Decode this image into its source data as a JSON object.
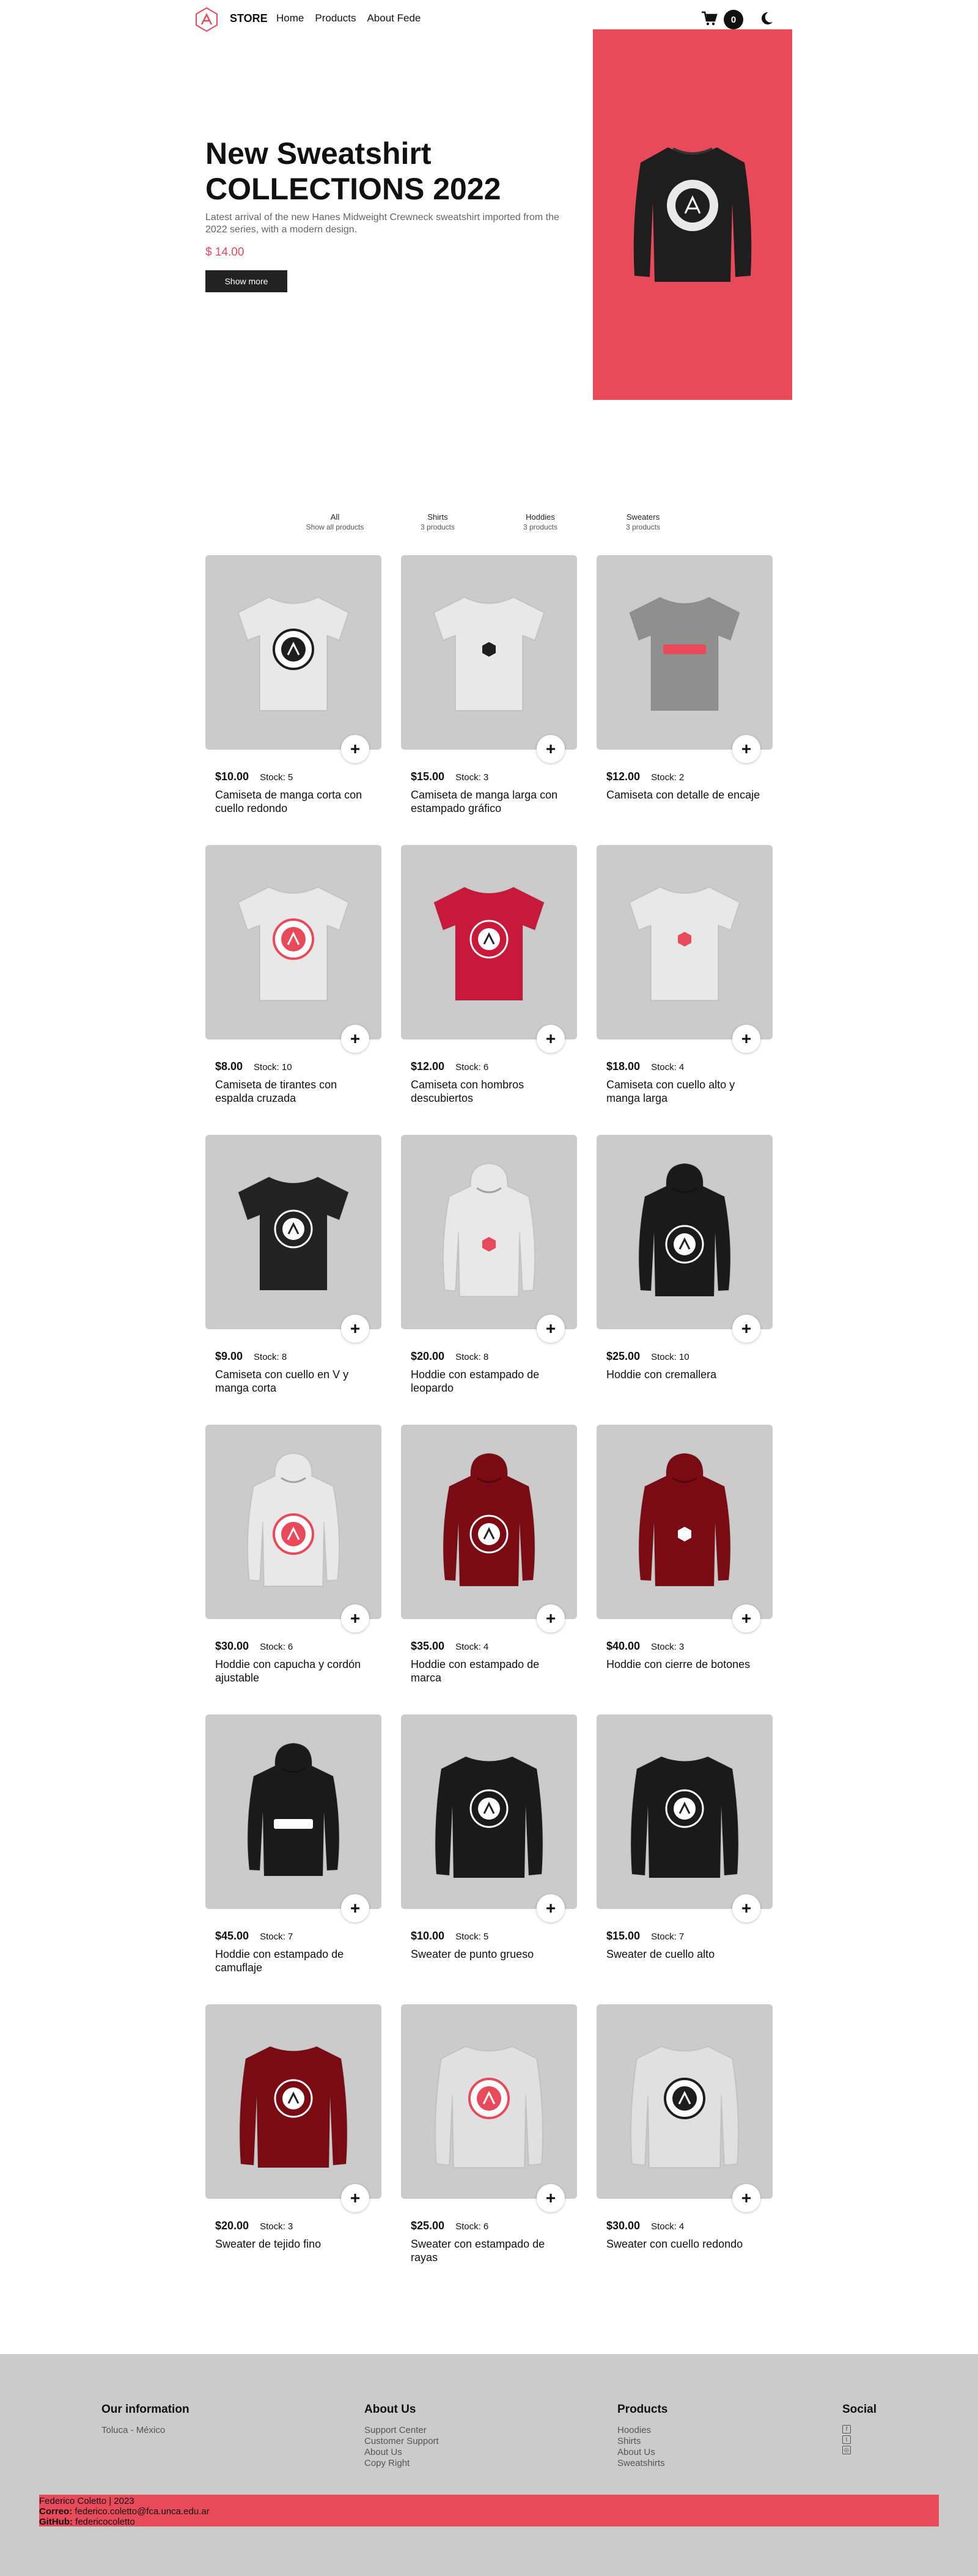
{
  "header": {
    "brand": "STORE",
    "nav": [
      "Home",
      "Products",
      "About Fede"
    ],
    "cart_count": "0",
    "icons": {
      "logo": "academlo-logo-icon",
      "cart": "cart-icon",
      "theme": "moon-icon"
    }
  },
  "hero": {
    "title": "New Sweatshirt COLLECTIONS 2022",
    "description": "Latest arrival of the new Hanes Midweight Crewneck sweatshirt imported from the 2022 series, with a modern design.",
    "price": "$ 14.00",
    "button": "Show more",
    "bg_color": "#e94a5a"
  },
  "filters": [
    {
      "label": "All",
      "count": "Show all products"
    },
    {
      "label": "Shirts",
      "count": "3 products"
    },
    {
      "label": "Hoddies",
      "count": "3 products"
    },
    {
      "label": "Sweaters",
      "count": "3 products"
    }
  ],
  "products": [
    {
      "price": "$10.00",
      "stock": "Stock: 5",
      "name": "Camiseta de manga corta con cuello redondo",
      "kind": "tshirt",
      "color": "#e8e8e8",
      "logo": "dark-badge"
    },
    {
      "price": "$15.00",
      "stock": "Stock: 3",
      "name": "Camiseta de manga larga con estampado gráfico",
      "kind": "tshirt",
      "color": "#e8e8e8",
      "logo": "small-dark"
    },
    {
      "price": "$12.00",
      "stock": "Stock: 2",
      "name": "Camiseta con detalle de encaje",
      "kind": "tshirt",
      "color": "#8f8f8f",
      "logo": "pink-text"
    },
    {
      "price": "$8.00",
      "stock": "Stock: 10",
      "name": "Camiseta de tirantes con espalda cruzada",
      "kind": "tshirt",
      "color": "#e8e8e8",
      "logo": "pink-badge"
    },
    {
      "price": "$12.00",
      "stock": "Stock: 6",
      "name": "Camiseta con hombros descubiertos",
      "kind": "tshirt",
      "color": "#c8193a",
      "logo": "white-badge"
    },
    {
      "price": "$18.00",
      "stock": "Stock: 4",
      "name": "Camiseta con cuello alto y manga larga",
      "kind": "tshirt",
      "color": "#e8e8e8",
      "logo": "small-pink"
    },
    {
      "price": "$9.00",
      "stock": "Stock: 8",
      "name": "Camiseta con cuello en V y manga corta",
      "kind": "tshirt",
      "color": "#222222",
      "logo": "white-badge"
    },
    {
      "price": "$20.00",
      "stock": "Stock: 8",
      "name": "Hoddie con estampado de leopardo",
      "kind": "hoodie",
      "color": "#e8e8e8",
      "logo": "small-pink"
    },
    {
      "price": "$25.00",
      "stock": "Stock: 10",
      "name": "Hoddie con cremallera",
      "kind": "hoodie",
      "color": "#1a1a1a",
      "logo": "white-badge"
    },
    {
      "price": "$30.00",
      "stock": "Stock: 6",
      "name": "Hoddie con capucha y cordón ajustable",
      "kind": "hoodie",
      "color": "#e8e8e8",
      "logo": "pink-badge"
    },
    {
      "price": "$35.00",
      "stock": "Stock: 4",
      "name": "Hoddie con estampado de marca",
      "kind": "hoodie",
      "color": "#7a0a14",
      "logo": "white-badge"
    },
    {
      "price": "$40.00",
      "stock": "Stock: 3",
      "name": "Hoddie con cierre de botones",
      "kind": "hoodie",
      "color": "#7a0a14",
      "logo": "small-white"
    },
    {
      "price": "$45.00",
      "stock": "Stock: 7",
      "name": "Hoddie con estampado de camuflaje",
      "kind": "hoodie",
      "color": "#1a1a1a",
      "logo": "white-text"
    },
    {
      "price": "$10.00",
      "stock": "Stock: 5",
      "name": "Sweater de punto grueso",
      "kind": "sweater",
      "color": "#1a1a1a",
      "logo": "white-badge"
    },
    {
      "price": "$15.00",
      "stock": "Stock: 7",
      "name": "Sweater de cuello alto",
      "kind": "sweater",
      "color": "#1a1a1a",
      "logo": "white-badge"
    },
    {
      "price": "$20.00",
      "stock": "Stock: 3",
      "name": "Sweater de tejido fino",
      "kind": "sweater",
      "color": "#7a0a14",
      "logo": "white-badge"
    },
    {
      "price": "$25.00",
      "stock": "Stock: 6",
      "name": "Sweater con estampado de rayas",
      "kind": "sweater",
      "color": "#e0e0e0",
      "logo": "pink-badge"
    },
    {
      "price": "$30.00",
      "stock": "Stock: 4",
      "name": "Sweater con cuello redondo",
      "kind": "sweater",
      "color": "#e0e0e0",
      "logo": "dark-badge"
    }
  ],
  "footer": {
    "info": {
      "title": "Our information",
      "items": [
        "Toluca - México"
      ]
    },
    "about": {
      "title": "About Us",
      "items": [
        "Support Center",
        "Customer Support",
        "About Us",
        "Copy Right"
      ]
    },
    "products": {
      "title": "Products",
      "items": [
        "Hoodies",
        "Shirts",
        "About Us",
        "Sweatshirts"
      ]
    },
    "social": {
      "title": "Social",
      "icons": [
        "facebook-icon",
        "twitter-icon",
        "instagram-icon"
      ]
    },
    "credits": {
      "line1": "Federico Coletto | 2023",
      "email_label": "Correo:",
      "email": "federico.coletto@fca.unca.edu.ar",
      "github_label": "GitHub:",
      "github": "federicocoletto"
    },
    "accent": "#e94a5a"
  }
}
